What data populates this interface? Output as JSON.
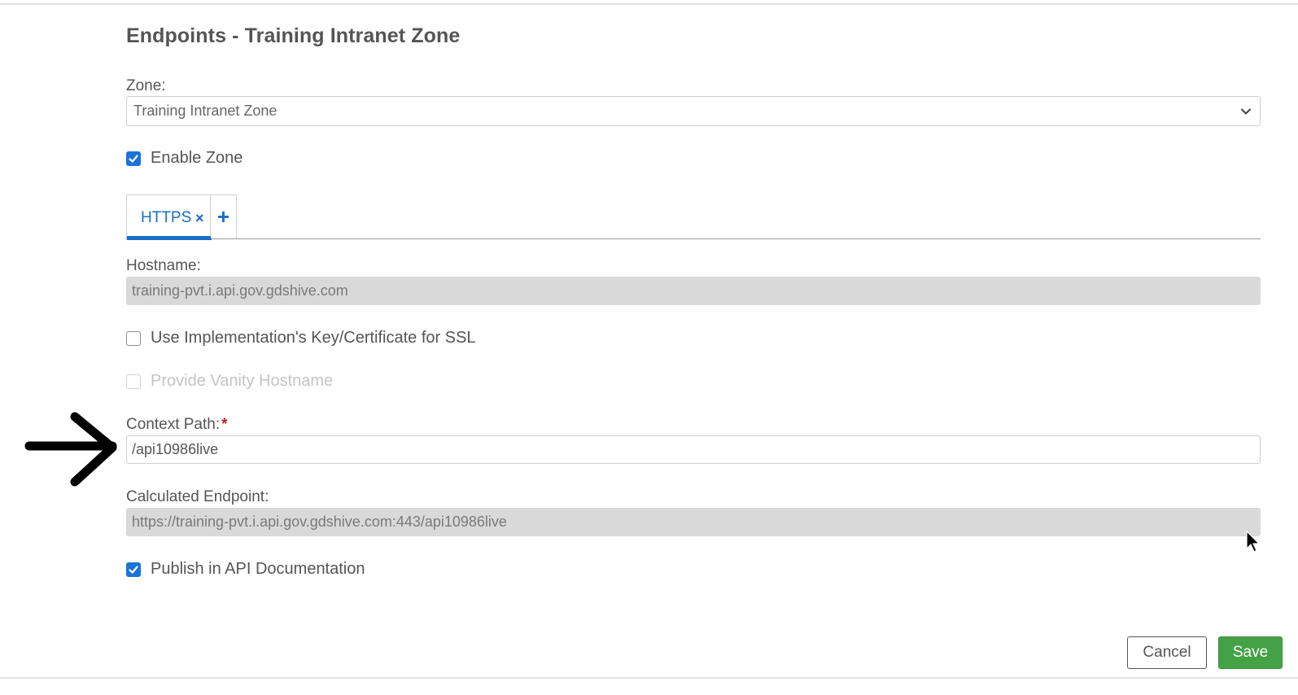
{
  "dialog": {
    "title": "Endpoints - Training Intranet Zone"
  },
  "zone": {
    "label": "Zone:",
    "selected": "Training Intranet Zone"
  },
  "enable_zone": {
    "label": "Enable Zone",
    "checked": true
  },
  "tabs": [
    {
      "label": "HTTPS",
      "close_glyph": "×",
      "active": true
    }
  ],
  "add_tab_glyph": "+",
  "hostname": {
    "label": "Hostname:",
    "value": "training-pvt.i.api.gov.gdshive.com"
  },
  "use_impl_key": {
    "label": "Use Implementation's Key/Certificate for SSL",
    "checked": false
  },
  "vanity_hostname": {
    "label": "Provide Vanity Hostname",
    "checked": false,
    "disabled": true
  },
  "context_path": {
    "label": "Context Path:",
    "required_mark": "*",
    "value": "/api10986live"
  },
  "calculated_endpoint": {
    "label": "Calculated Endpoint:",
    "value": "https://training-pvt.i.api.gov.gdshive.com:443/api10986live"
  },
  "publish_docs": {
    "label": "Publish in API Documentation",
    "checked": true
  },
  "buttons": {
    "cancel": "Cancel",
    "save": "Save"
  },
  "colors": {
    "accent": "#1a6fc4",
    "checkbox": "#1a73d9",
    "save": "#45a145",
    "required": "#c01d1d",
    "readonly_bg": "#d9d9d9"
  },
  "icons": {
    "arrow": "arrow-right-icon",
    "cursor": "mouse-cursor-icon",
    "dropdown": "chevron-down-icon",
    "check": "check-icon"
  }
}
